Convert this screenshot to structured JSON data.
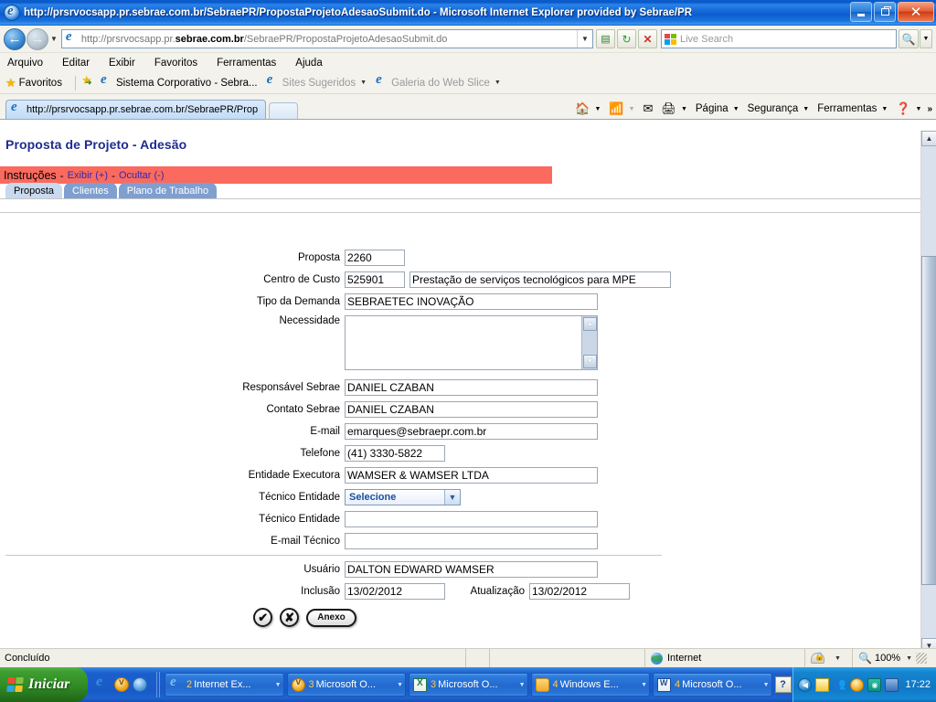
{
  "window": {
    "title": "http://prsrvocsapp.pr.sebrae.com.br/SebraePR/PropostaProjetoAdesaoSubmit.do - Microsoft Internet Explorer provided by Sebrae/PR",
    "minimize_label": "Minimizar",
    "restore_label": "Restaurar",
    "close_label": "Fechar"
  },
  "address_bar": {
    "url_prefix": "http://prsrvocsapp.pr.",
    "url_domain": "sebrae.com.br",
    "url_path": "/SebraePR/PropostaProjetoAdesaoSubmit.do",
    "full_url": "http://prsrvocsapp.pr.sebrae.com.br/SebraePR/PropostaProjetoAdesaoSubmit.do",
    "back_label": "Voltar",
    "forward_label": "Avançar",
    "compat_label": "Modo de Exibição de Compatibilidade",
    "refresh_label": "Atualizar",
    "stop_label": "Parar",
    "search_placeholder": "Live Search",
    "search_value": "",
    "go_label": "Pesquisar"
  },
  "menu": {
    "items": [
      "Arquivo",
      "Editar",
      "Exibir",
      "Favoritos",
      "Ferramentas",
      "Ajuda"
    ]
  },
  "favorites_bar": {
    "favorites_label": "Favoritos",
    "items": [
      {
        "label": "Sistema Corporativo - Sebra...",
        "dimmed": false,
        "has_caret": false
      },
      {
        "label": "Sites Sugeridos",
        "dimmed": true,
        "has_caret": true
      },
      {
        "label": "Galeria do Web Slice",
        "dimmed": true,
        "has_caret": true
      }
    ]
  },
  "browser_tabs": {
    "active_tab": "http://prsrvocsapp.pr.sebrae.com.br/SebraePR/Prop...",
    "new_tab_label": "Nova Guia"
  },
  "command_bar": {
    "home_label": "Página Inicial",
    "feeds_label": "Feeds",
    "mail_label": "Ler Email",
    "print_label": "Imprimir",
    "items": [
      "Página",
      "Segurança",
      "Ferramentas"
    ],
    "help_label": "Ajuda",
    "overflow_label": "»"
  },
  "page": {
    "title": "Proposta de Projeto - Adesão",
    "instructions": {
      "label": "Instruções",
      "separator": "-",
      "show_link": "Exibir (+)",
      "hide_link": "Ocultar (-)",
      "bar_color": "#fb6a5e"
    },
    "tabs": [
      {
        "label": "Proposta",
        "active": true
      },
      {
        "label": "Clientes",
        "active": false
      },
      {
        "label": "Plano de Trabalho",
        "active": false
      }
    ],
    "form": {
      "proposta_label": "Proposta",
      "proposta_value": "2260",
      "centro_custo_label": "Centro de Custo",
      "centro_custo_code": "525901",
      "centro_custo_desc": "Prestação de serviços tecnológicos para MPE",
      "tipo_demanda_label": "Tipo da Demanda",
      "tipo_demanda_value": "SEBRAETEC INOVAÇÃO",
      "necessidade_label": "Necessidade",
      "necessidade_value": "",
      "responsavel_sebrae_label": "Responsável Sebrae",
      "responsavel_sebrae_value": "DANIEL CZABAN",
      "contato_sebrae_label": "Contato Sebrae",
      "contato_sebrae_value": "DANIEL CZABAN",
      "email_label": "E-mail",
      "email_value": "emarques@sebraepr.com.br",
      "telefone_label": "Telefone",
      "telefone_value": "(41) 3330-5822",
      "entidade_executora_label": "Entidade Executora",
      "entidade_executora_value": "WAMSER & WAMSER LTDA",
      "tecnico_entidade_select_label": "Técnico Entidade",
      "tecnico_entidade_select_value": "Selecione",
      "tecnico_entidade_label": "Técnico Entidade",
      "tecnico_entidade_value": "",
      "email_tecnico_label": "E-mail Técnico",
      "email_tecnico_value": "",
      "usuario_label": "Usuário",
      "usuario_value": "DALTON EDWARD WAMSER",
      "inclusao_label": "Inclusão",
      "inclusao_value": "13/02/2012",
      "atualizacao_label": "Atualização",
      "atualizacao_value": "13/02/2012"
    },
    "actions": {
      "confirm_label": "✔",
      "cancel_label": "✘",
      "attachment_label": "Anexo"
    }
  },
  "status_bar": {
    "message": "Concluído",
    "zone": "Internet",
    "zoom": "100%"
  },
  "taskbar": {
    "start_label": "Iniciar",
    "quick_launch": [
      "ie-icon",
      "outlook-icon",
      "media-icon"
    ],
    "tasks": [
      {
        "count": "2",
        "label": "Internet Ex...",
        "icon": "ie-icon"
      },
      {
        "count": "3",
        "label": "Microsoft O...",
        "icon": "outlook-icon"
      },
      {
        "count": "3",
        "label": "Microsoft O...",
        "icon": "excel-icon"
      },
      {
        "count": "4",
        "label": "Windows E...",
        "icon": "folder-icon"
      },
      {
        "count": "4",
        "label": "Microsoft O...",
        "icon": "word-icon"
      }
    ],
    "help_badge": "?",
    "tray_icons": [
      "show-hidden-icon",
      "mail-icon",
      "people-icon",
      "outlook-icon",
      "eye-icon",
      "network-icon"
    ],
    "clock": "17:22"
  }
}
